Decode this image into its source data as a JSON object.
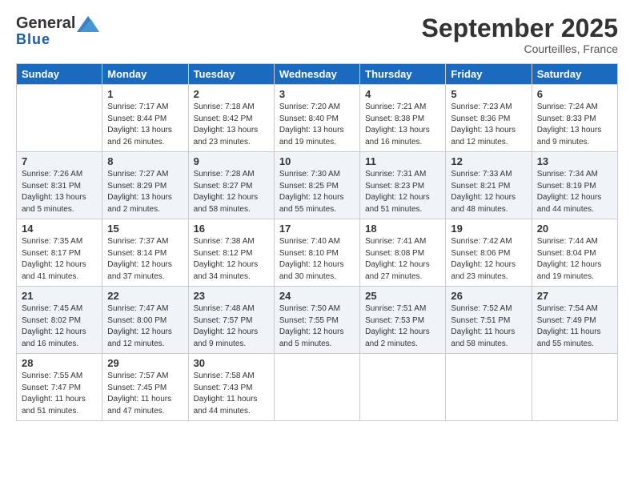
{
  "header": {
    "logo_general": "General",
    "logo_blue": "Blue",
    "month_title": "September 2025",
    "location": "Courteilles, France"
  },
  "weekdays": [
    "Sunday",
    "Monday",
    "Tuesday",
    "Wednesday",
    "Thursday",
    "Friday",
    "Saturday"
  ],
  "weeks": [
    [
      {
        "day": "",
        "info": ""
      },
      {
        "day": "1",
        "info": "Sunrise: 7:17 AM\nSunset: 8:44 PM\nDaylight: 13 hours\nand 26 minutes."
      },
      {
        "day": "2",
        "info": "Sunrise: 7:18 AM\nSunset: 8:42 PM\nDaylight: 13 hours\nand 23 minutes."
      },
      {
        "day": "3",
        "info": "Sunrise: 7:20 AM\nSunset: 8:40 PM\nDaylight: 13 hours\nand 19 minutes."
      },
      {
        "day": "4",
        "info": "Sunrise: 7:21 AM\nSunset: 8:38 PM\nDaylight: 13 hours\nand 16 minutes."
      },
      {
        "day": "5",
        "info": "Sunrise: 7:23 AM\nSunset: 8:36 PM\nDaylight: 13 hours\nand 12 minutes."
      },
      {
        "day": "6",
        "info": "Sunrise: 7:24 AM\nSunset: 8:33 PM\nDaylight: 13 hours\nand 9 minutes."
      }
    ],
    [
      {
        "day": "7",
        "info": "Sunrise: 7:26 AM\nSunset: 8:31 PM\nDaylight: 13 hours\nand 5 minutes."
      },
      {
        "day": "8",
        "info": "Sunrise: 7:27 AM\nSunset: 8:29 PM\nDaylight: 13 hours\nand 2 minutes."
      },
      {
        "day": "9",
        "info": "Sunrise: 7:28 AM\nSunset: 8:27 PM\nDaylight: 12 hours\nand 58 minutes."
      },
      {
        "day": "10",
        "info": "Sunrise: 7:30 AM\nSunset: 8:25 PM\nDaylight: 12 hours\nand 55 minutes."
      },
      {
        "day": "11",
        "info": "Sunrise: 7:31 AM\nSunset: 8:23 PM\nDaylight: 12 hours\nand 51 minutes."
      },
      {
        "day": "12",
        "info": "Sunrise: 7:33 AM\nSunset: 8:21 PM\nDaylight: 12 hours\nand 48 minutes."
      },
      {
        "day": "13",
        "info": "Sunrise: 7:34 AM\nSunset: 8:19 PM\nDaylight: 12 hours\nand 44 minutes."
      }
    ],
    [
      {
        "day": "14",
        "info": "Sunrise: 7:35 AM\nSunset: 8:17 PM\nDaylight: 12 hours\nand 41 minutes."
      },
      {
        "day": "15",
        "info": "Sunrise: 7:37 AM\nSunset: 8:14 PM\nDaylight: 12 hours\nand 37 minutes."
      },
      {
        "day": "16",
        "info": "Sunrise: 7:38 AM\nSunset: 8:12 PM\nDaylight: 12 hours\nand 34 minutes."
      },
      {
        "day": "17",
        "info": "Sunrise: 7:40 AM\nSunset: 8:10 PM\nDaylight: 12 hours\nand 30 minutes."
      },
      {
        "day": "18",
        "info": "Sunrise: 7:41 AM\nSunset: 8:08 PM\nDaylight: 12 hours\nand 27 minutes."
      },
      {
        "day": "19",
        "info": "Sunrise: 7:42 AM\nSunset: 8:06 PM\nDaylight: 12 hours\nand 23 minutes."
      },
      {
        "day": "20",
        "info": "Sunrise: 7:44 AM\nSunset: 8:04 PM\nDaylight: 12 hours\nand 19 minutes."
      }
    ],
    [
      {
        "day": "21",
        "info": "Sunrise: 7:45 AM\nSunset: 8:02 PM\nDaylight: 12 hours\nand 16 minutes."
      },
      {
        "day": "22",
        "info": "Sunrise: 7:47 AM\nSunset: 8:00 PM\nDaylight: 12 hours\nand 12 minutes."
      },
      {
        "day": "23",
        "info": "Sunrise: 7:48 AM\nSunset: 7:57 PM\nDaylight: 12 hours\nand 9 minutes."
      },
      {
        "day": "24",
        "info": "Sunrise: 7:50 AM\nSunset: 7:55 PM\nDaylight: 12 hours\nand 5 minutes."
      },
      {
        "day": "25",
        "info": "Sunrise: 7:51 AM\nSunset: 7:53 PM\nDaylight: 12 hours\nand 2 minutes."
      },
      {
        "day": "26",
        "info": "Sunrise: 7:52 AM\nSunset: 7:51 PM\nDaylight: 11 hours\nand 58 minutes."
      },
      {
        "day": "27",
        "info": "Sunrise: 7:54 AM\nSunset: 7:49 PM\nDaylight: 11 hours\nand 55 minutes."
      }
    ],
    [
      {
        "day": "28",
        "info": "Sunrise: 7:55 AM\nSunset: 7:47 PM\nDaylight: 11 hours\nand 51 minutes."
      },
      {
        "day": "29",
        "info": "Sunrise: 7:57 AM\nSunset: 7:45 PM\nDaylight: 11 hours\nand 47 minutes."
      },
      {
        "day": "30",
        "info": "Sunrise: 7:58 AM\nSunset: 7:43 PM\nDaylight: 11 hours\nand 44 minutes."
      },
      {
        "day": "",
        "info": ""
      },
      {
        "day": "",
        "info": ""
      },
      {
        "day": "",
        "info": ""
      },
      {
        "day": "",
        "info": ""
      }
    ]
  ]
}
